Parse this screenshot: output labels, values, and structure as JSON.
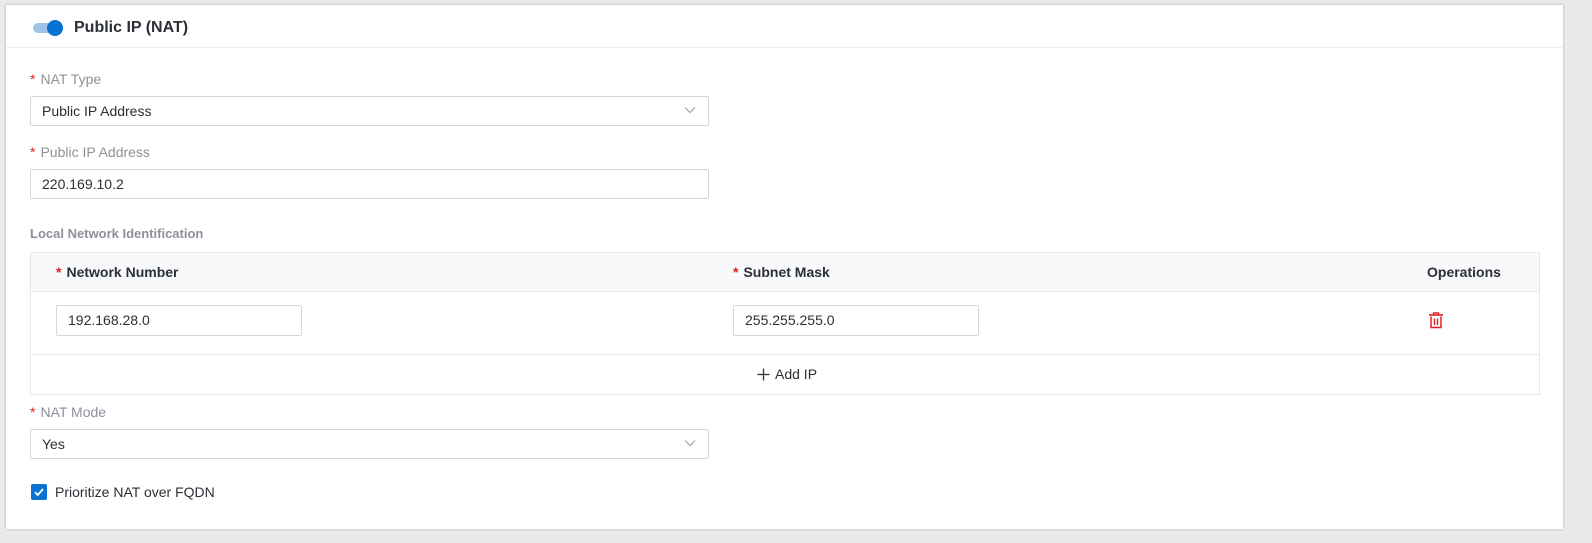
{
  "header": {
    "toggle_on": true,
    "title": "Public IP (NAT)"
  },
  "form": {
    "nat_type": {
      "label": "NAT Type",
      "required_mark": "*",
      "value": "Public IP Address"
    },
    "public_ip": {
      "label": "Public IP Address",
      "required_mark": "*",
      "value": "220.169.10.2"
    },
    "local_network": {
      "title": "Local Network Identification",
      "columns": {
        "network_number": "Network Number",
        "subnet_mask": "Subnet Mask",
        "operations": "Operations"
      },
      "rows": [
        {
          "network_number": "192.168.28.0",
          "subnet_mask": "255.255.255.0"
        }
      ],
      "add_label": "Add IP"
    },
    "nat_mode": {
      "label": "NAT Mode",
      "required_mark": "*",
      "value": "Yes"
    },
    "prioritize": {
      "label": "Prioritize NAT over FQDN",
      "checked": true
    }
  },
  "colors": {
    "accent": "#0a72d4",
    "required": "#e02020",
    "delete": "#e02020"
  },
  "icons": {
    "toggle": "toggle-switch-icon",
    "select_arrow": "chevron-down-icon",
    "delete": "trash-icon",
    "add": "plus-icon",
    "checkbox": "checkmark-icon"
  }
}
